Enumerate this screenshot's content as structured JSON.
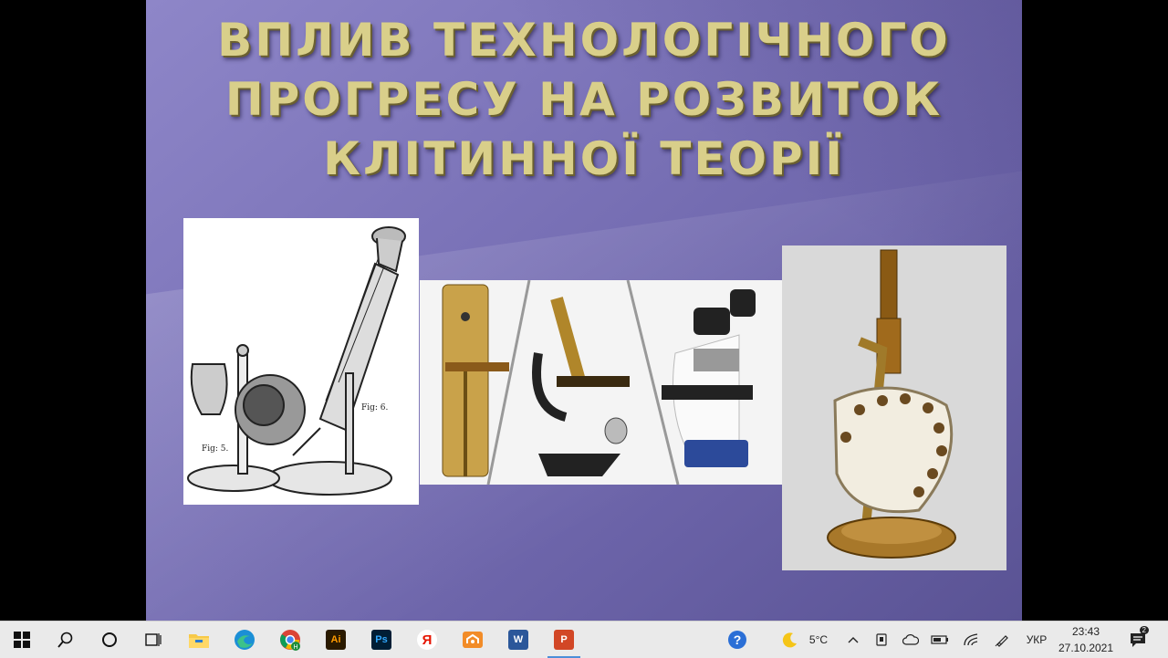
{
  "slide": {
    "title_lines": [
      "ВПЛИВ ТЕХНОЛОГІЧНОГО",
      "ПРОГРЕСУ НА РОЗВИТОК",
      "КЛІТИННОЇ ТЕОРІЇ"
    ],
    "images": [
      {
        "name": "hooke-microscope-engraving",
        "fig_labels": [
          "Fig: 5.",
          "Fig: 6."
        ]
      },
      {
        "name": "microscope-evolution-strip"
      },
      {
        "name": "brass-antique-microscope"
      }
    ]
  },
  "taskbar": {
    "apps": [
      {
        "name": "file-explorer",
        "icon": "folder-icon"
      },
      {
        "name": "edge",
        "icon": "edge-icon"
      },
      {
        "name": "chrome",
        "icon": "chrome-icon",
        "badge": "H"
      },
      {
        "name": "illustrator",
        "label": "Ai",
        "color": "#2a1a00",
        "text_color": "#ff9a00"
      },
      {
        "name": "photoshop",
        "label": "Ps",
        "color": "#001e36",
        "text_color": "#31a8ff"
      },
      {
        "name": "yandex",
        "label": "Я",
        "color": "#ffffff",
        "text_color": "#e61400"
      },
      {
        "name": "network-app",
        "icon": "network-icon"
      },
      {
        "name": "word",
        "label": "W",
        "color": "#2b579a",
        "text_color": "#ffffff"
      },
      {
        "name": "powerpoint",
        "label": "P",
        "color": "#d24726",
        "text_color": "#ffffff",
        "active": true
      }
    ],
    "tray": {
      "temperature": "5°C",
      "language": "УКР",
      "time": "23:43",
      "date": "27.10.2021",
      "notification_count": "2"
    }
  }
}
